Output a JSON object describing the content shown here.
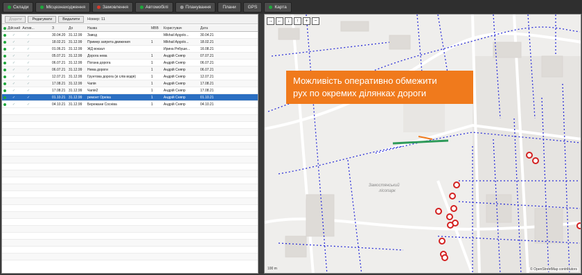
{
  "tabs": [
    {
      "label": "Склади",
      "dot": "#1fa83b"
    },
    {
      "label": "Місцезнаходження",
      "dot": "#1fa83b"
    },
    {
      "label": "Замовлення",
      "dot": "#d83a2a"
    },
    {
      "label": "Автомобілі",
      "dot": "#1fa83b"
    },
    {
      "label": "Планування",
      "dot": "#9a9a9a"
    },
    {
      "label": "Плани",
      "dot": ""
    },
    {
      "label": "GPS",
      "dot": ""
    },
    {
      "label": "Карта",
      "dot": "#1fa83b"
    }
  ],
  "toolbar": {
    "add_label": "Додати",
    "edit_label": "Редагувати",
    "delete_label": "Видалити",
    "record_number": "Номер: 11"
  },
  "table": {
    "headers": [
      "Дійсний",
      "Актив...",
      "З",
      "До",
      "Назва",
      "МВВ",
      "Користувач",
      "Дата"
    ],
    "rows": [
      {
        "from": "30.04.20",
        "to": "31.12.99",
        "name": "Завод",
        "mvv": "",
        "user": "Mikhail Apgolo...",
        "date": "30.04.21"
      },
      {
        "from": "18.02.21",
        "to": "31.12.99",
        "name": "Пример запрета движения",
        "mvv": "1",
        "user": "Mikhail Apgolo...",
        "date": "18.02.21"
      },
      {
        "from": "01.06.21",
        "to": "31.12.99",
        "name": "ЖД вокзал",
        "mvv": "",
        "user": "Ирина Рябуше...",
        "date": "16.08.21"
      },
      {
        "from": "05.07.21",
        "to": "31.12.99",
        "name": "Дорога нева",
        "mvv": "1",
        "user": "Андрій Сняпр",
        "date": "07.07.21"
      },
      {
        "from": "06.07.21",
        "to": "31.12.99",
        "name": "Погана дорога",
        "mvv": "1",
        "user": "Андрій Сняпр",
        "date": "06.07.21"
      },
      {
        "from": "06.07.21",
        "to": "31.12.99",
        "name": "Нема дороги",
        "mvv": "1",
        "user": "Андрій Сняпр",
        "date": "06.07.21"
      },
      {
        "from": "12.07.21",
        "to": "31.12.99",
        "name": "Грунтова дорога (зі слів водія)",
        "mvv": "1",
        "user": "Андрій Сняпр",
        "date": "12.07.21"
      },
      {
        "from": "17.08.21",
        "to": "31.12.99",
        "name": "Чапія",
        "mvv": "1",
        "user": "Андрій Сняпр",
        "date": "17.08.21"
      },
      {
        "from": "17.08.21",
        "to": "31.12.99",
        "name": "Чапія2",
        "mvv": "1",
        "user": "Андрій Сняпр",
        "date": "17.08.21"
      },
      {
        "from": "01.10.21",
        "to": "31.12.99",
        "name": "ремонт Ореіка",
        "mvv": "1",
        "user": "Андрій Сняпр",
        "date": "01.10.21",
        "selected": true
      },
      {
        "from": "04.10.21",
        "to": "31.12.99",
        "name": "Бережани Сосніва",
        "mvv": "1",
        "user": "Андрій Сняпр",
        "date": "04.10.21"
      }
    ],
    "empty_rows": 22
  },
  "map": {
    "controls": [
      "→",
      "←",
      "↓",
      "↑",
      "+",
      "−"
    ],
    "callout_line1": "Можливість оперативно обмежити",
    "callout_line2": "рух по окремих ділянках дороги",
    "park_label_1": "Замостянський",
    "park_label_2": "лісопарк",
    "scale_label": "100 m",
    "attribution": "© OpenStreetMap contributors"
  }
}
